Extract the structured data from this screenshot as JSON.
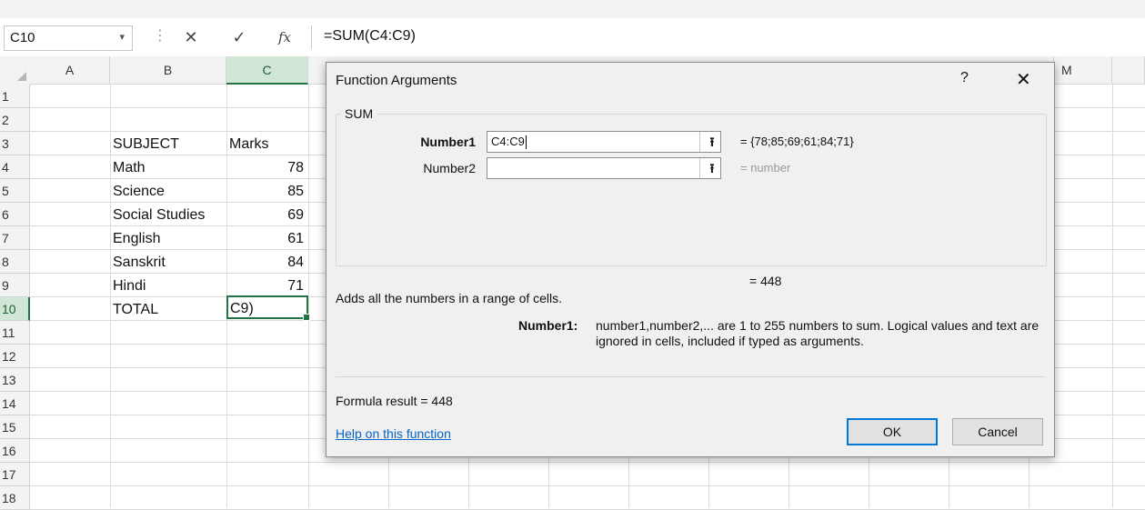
{
  "formula_bar": {
    "name_box": "C10",
    "name_box_dropdown": "▾",
    "dots": "⋮",
    "cancel_glyph": "✕",
    "enter_glyph": "✓",
    "fx_glyph": "fx",
    "formula": "=SUM(C4:C9)"
  },
  "columns": [
    "A",
    "B",
    "C",
    "M"
  ],
  "rows": [
    "1",
    "2",
    "3",
    "4",
    "5",
    "6",
    "7",
    "8",
    "9",
    "10",
    "11",
    "12",
    "13",
    "14",
    "15",
    "16",
    "17",
    "18"
  ],
  "sheet": {
    "subject_header": "SUBJECT",
    "marks_header": "Marks",
    "subjects": [
      "Math",
      "Science",
      "Social Studies",
      "English",
      "Sanskrit",
      "Hindi"
    ],
    "marks": [
      "78",
      "85",
      "69",
      "61",
      "84",
      "71"
    ],
    "total_label": "TOTAL",
    "active_cell_text": "C9)"
  },
  "dialog": {
    "title": "Function Arguments",
    "help_button": "?",
    "close_button": "✕",
    "function_name": "SUM",
    "arg1_label": "Number1",
    "arg1_value": "C4:C9",
    "arg1_result": "=  {78;85;69;61;84;71}",
    "arg2_label": "Number2",
    "arg2_value": "",
    "arg2_result": "=  number",
    "collapse_glyph": "⭱",
    "overall_result": "=  448",
    "description": "Adds all the numbers in a range of cells.",
    "arg_help_name": "Number1:",
    "arg_help_text": "number1,number2,... are 1 to 255 numbers to sum. Logical values and text are ignored in cells, included if typed as arguments.",
    "formula_result": "Formula result =   448",
    "help_link": "Help on this function",
    "ok": "OK",
    "cancel": "Cancel"
  },
  "colors": {
    "accent_green": "#217346",
    "selected_header": "#d2e6d6",
    "ok_border": "#0078d7",
    "link": "#0563c1"
  }
}
